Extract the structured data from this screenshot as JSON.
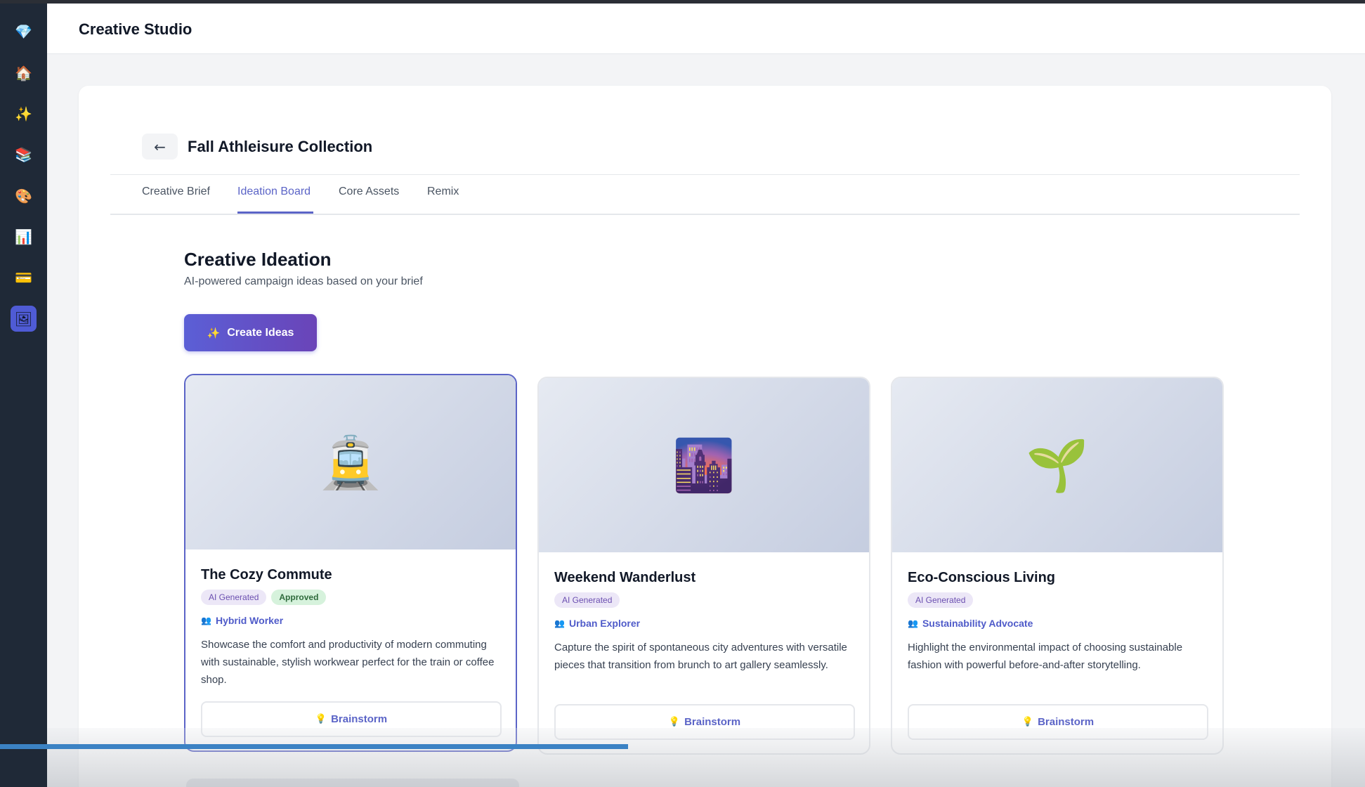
{
  "app": {
    "title": "Creative Studio"
  },
  "sidebar": {
    "items": [
      {
        "name": "logo-gem-icon",
        "glyph": "💎"
      },
      {
        "name": "home-icon",
        "glyph": "🏠"
      },
      {
        "name": "sparkles-icon",
        "glyph": "✨"
      },
      {
        "name": "library-icon",
        "glyph": "📚"
      },
      {
        "name": "palette-icon",
        "glyph": "🎨"
      },
      {
        "name": "chart-icon",
        "glyph": "📊"
      },
      {
        "name": "card-icon",
        "glyph": "💳"
      },
      {
        "name": "gallery-icon",
        "glyph": "🖼"
      }
    ]
  },
  "project": {
    "back_glyph": "←",
    "title": "Fall Athleisure Collection"
  },
  "tabs": [
    {
      "label": "Creative Brief"
    },
    {
      "label": "Ideation Board",
      "active": true
    },
    {
      "label": "Core Assets"
    },
    {
      "label": "Remix"
    }
  ],
  "section": {
    "title": "Creative Ideation",
    "subtitle": "AI-powered campaign ideas based on your brief"
  },
  "create_button": {
    "icon": "✨",
    "label": "Create Ideas"
  },
  "cards": [
    {
      "icon": "🚊",
      "title": "The Cozy Commute",
      "badges": [
        "AI Generated",
        "Approved"
      ],
      "persona": "Hybrid Worker",
      "description": "Showcase the comfort and productivity of modern commuting with sustainable, stylish workwear perfect for the train or coffee shop.",
      "button": "Brainstorm",
      "selected": true
    },
    {
      "icon": "🌆",
      "title": "Weekend Wanderlust",
      "badges": [
        "AI Generated"
      ],
      "persona": "Urban Explorer",
      "description": "Capture the spirit of spontaneous city adventures with versatile pieces that transition from brunch to art gallery seamlessly.",
      "button": "Brainstorm"
    },
    {
      "icon": "🌱",
      "title": "Eco-Conscious Living",
      "badges": [
        "AI Generated"
      ],
      "persona": "Sustainability Advocate",
      "description": "Highlight the environmental impact of choosing sustainable fashion with powerful before-and-after storytelling.",
      "button": "Brainstorm"
    }
  ],
  "glyphs": {
    "persona": "👥",
    "bulb": "💡"
  },
  "colors": {
    "accent": "#5b64c7",
    "sidebar": "#1f2937",
    "progress": "#3b82c4"
  },
  "playback": {
    "progress_fraction": 0.46
  }
}
